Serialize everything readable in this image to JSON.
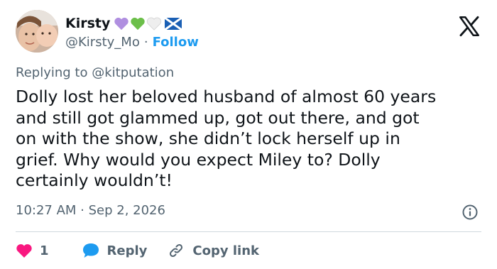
{
  "user": {
    "display_name": "Kirsty",
    "handle": "@Kirsty_Mo",
    "follow_label": "Follow",
    "separator": "·",
    "badges": [
      "purple-heart-icon",
      "green-heart-icon",
      "white-heart-icon",
      "scotland-flag-icon"
    ]
  },
  "reply": {
    "prefix": "Replying to",
    "mention": "@kitputation"
  },
  "tweet": {
    "text": "Dolly lost her beloved husband of almost 60 years\nand still got glammed up, got out there, and got\non with the show, she didn’t lock herself up in\ngrief. Why would you expect Miley to? Dolly\ncertainly wouldn’t!",
    "timestamp": "10:27 AM · Sep 2, 2026"
  },
  "actions": {
    "like_count": "1",
    "reply_label": "Reply",
    "copy_link_label": "Copy link"
  },
  "colors": {
    "like": "#f91880",
    "reply": "#1d9bf0",
    "link": "#1d9bf0",
    "secondary_text": "#536471"
  }
}
